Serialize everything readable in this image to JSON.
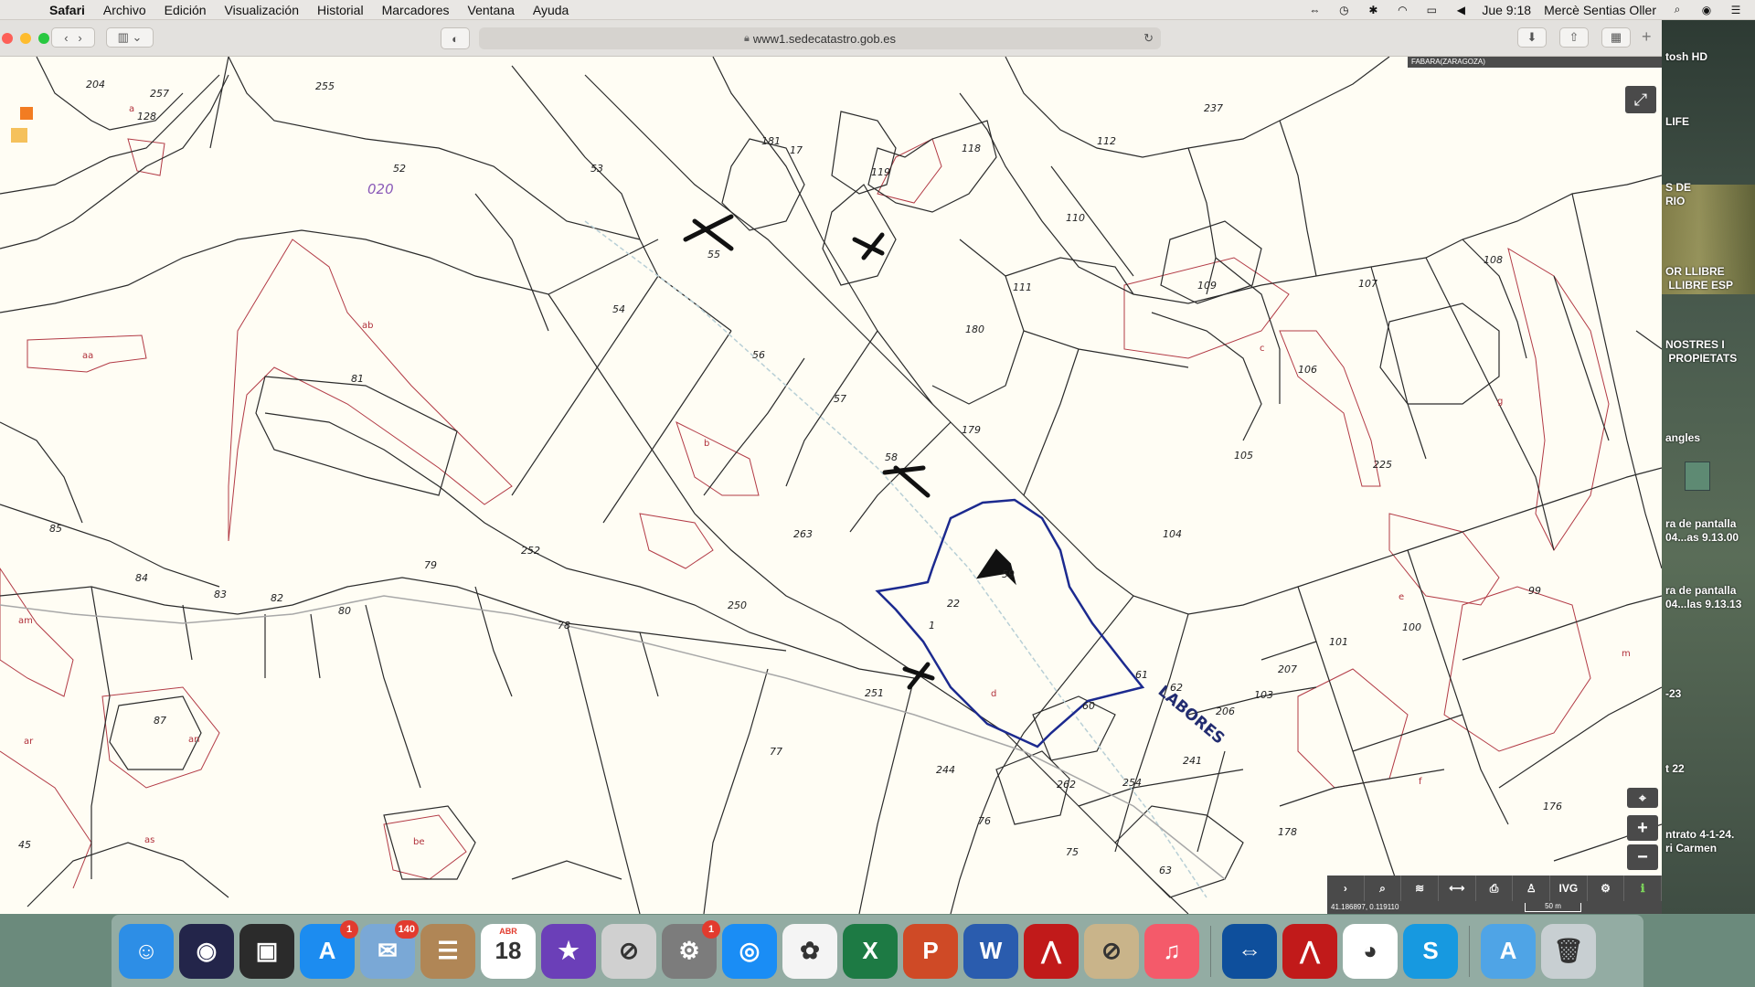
{
  "menubar": {
    "app": "Safari",
    "items": [
      "Archivo",
      "Edición",
      "Visualización",
      "Historial",
      "Marcadores",
      "Ventana",
      "Ayuda"
    ],
    "time": "Jue 9:18",
    "user": "Mercè Sentias Oller"
  },
  "browser": {
    "url": "www1.sedecatastro.gob.es",
    "location_label": "FABARA(ZARAGOZA)"
  },
  "map": {
    "polygon_label": "020",
    "street_label": "LABORES",
    "parcel_numbers": [
      "204",
      "257",
      "128",
      "255",
      "52",
      "53",
      "181",
      "119",
      "118",
      "112",
      "237",
      "55",
      "54",
      "110",
      "111",
      "109",
      "107",
      "108",
      "56",
      "180",
      "81",
      "57",
      "179",
      "106",
      "58",
      "105",
      "225",
      "263",
      "59",
      "104",
      "85",
      "84",
      "83",
      "82",
      "79",
      "252",
      "80",
      "250",
      "78",
      "101",
      "100",
      "99",
      "207",
      "61",
      "62",
      "103",
      "60",
      "206",
      "87",
      "77",
      "251",
      "244",
      "241",
      "76",
      "262",
      "254",
      "176",
      "75",
      "63",
      "45",
      "178",
      "1",
      "17",
      "22"
    ],
    "subparcel_letters": [
      "a",
      "ab",
      "aa",
      "b",
      "c",
      "d",
      "e",
      "f",
      "g",
      "m",
      "am",
      "an",
      "ar",
      "as",
      "be"
    ],
    "coordinates": "41.186897, 0.119110",
    "scale": "50 m",
    "tool_labels": [
      "›",
      "⌕",
      "≋",
      "⟷",
      "⎙",
      "♙",
      "IVG",
      "⚙",
      "ℹ"
    ]
  },
  "desktop_labels": [
    "tosh HD",
    "LIFE",
    "S DE\nRIO",
    "OR LLIBRE\n LLIBRE ESP",
    "NOSTRES I\n PROPIETATS",
    "angles",
    "ra de pantalla\n04...as 9.13.00",
    "ra de pantalla\n04...las 9.13.13",
    "-23",
    "t 22",
    "ntrato 4-1-24.\nri Carmen"
  ],
  "dock": {
    "apps": [
      {
        "name": "Finder",
        "color": "#2d8ee6",
        "glyph": "☺"
      },
      {
        "name": "Siri",
        "color": "#23254a",
        "glyph": "◉"
      },
      {
        "name": "Photo Booth",
        "color": "#2b2b2b",
        "glyph": "▣"
      },
      {
        "name": "App Store",
        "color": "#1c8cf0",
        "glyph": "A",
        "badge": "1"
      },
      {
        "name": "Mail",
        "color": "#7aa8d6",
        "glyph": "✉",
        "badge": "140"
      },
      {
        "name": "Contacts",
        "color": "#b08656",
        "glyph": "☰"
      },
      {
        "name": "Calendar",
        "color": "#ffffff",
        "glyph": "18",
        "month": "ABR"
      },
      {
        "name": "iMovie",
        "color": "#6b3fb8",
        "glyph": "★"
      },
      {
        "name": "Blocked App",
        "color": "#d0d0d0",
        "glyph": "⊘"
      },
      {
        "name": "System Preferences",
        "color": "#7c7c7c",
        "glyph": "⚙",
        "badge": "1"
      },
      {
        "name": "Safari",
        "color": "#1a8df5",
        "glyph": "◎"
      },
      {
        "name": "Photos",
        "color": "#f4f4f4",
        "glyph": "✿"
      },
      {
        "name": "Excel",
        "color": "#1d7a44",
        "glyph": "X"
      },
      {
        "name": "PowerPoint",
        "color": "#cf4a26",
        "glyph": "P"
      },
      {
        "name": "Word",
        "color": "#2a5cae",
        "glyph": "W"
      },
      {
        "name": "Acrobat",
        "color": "#c11a1a",
        "glyph": "⋀"
      },
      {
        "name": "Preview",
        "color": "#c9b48a",
        "glyph": "⊘"
      },
      {
        "name": "Music",
        "color": "#f45a6a",
        "glyph": "♫"
      },
      {
        "name": "TeamViewer",
        "color": "#0e4f9c",
        "glyph": "⇔"
      },
      {
        "name": "Acrobat Reader",
        "color": "#c11a1a",
        "glyph": "⋀"
      },
      {
        "name": "Chrome",
        "color": "#ffffff",
        "glyph": "◕"
      },
      {
        "name": "Skype",
        "color": "#1799e0",
        "glyph": "S"
      },
      {
        "name": "Applications",
        "color": "#4fa4e6",
        "glyph": "A"
      },
      {
        "name": "Trash",
        "color": "#c8cfd2",
        "glyph": "🗑"
      }
    ]
  }
}
